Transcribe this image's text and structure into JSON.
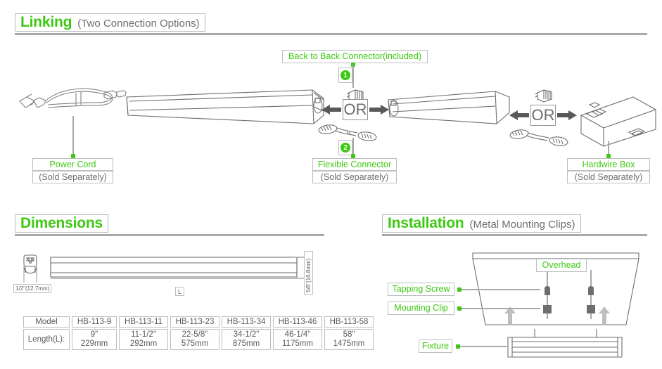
{
  "sections": {
    "linking": {
      "title": "Linking",
      "subtitle": "(Two Connection Options)"
    },
    "dimensions": {
      "title": "Dimensions",
      "subtitle": ""
    },
    "installation": {
      "title": "Installation",
      "subtitle": "(Metal Mounting Clips)"
    }
  },
  "linking": {
    "power_cord": {
      "name": "Power Cord",
      "note": "(Sold Separately)"
    },
    "back_to_back": {
      "name": "Back to Back Connector(included)",
      "badge": "1"
    },
    "flexible": {
      "name": "Flexible Connector",
      "note": "(Sold Separately)",
      "badge": "2"
    },
    "hardwire": {
      "name": "Hardwire Box",
      "note": "(Sold Separately)"
    },
    "or_left": "OR",
    "or_right": "OR"
  },
  "dimensions": {
    "width_label": "1/2\"(12.7mm)",
    "height_label": "5/8\"(16.8mm)",
    "length_marker": "L",
    "table": {
      "row_headers": [
        "Model",
        "Length(L):"
      ],
      "models": [
        "HB-113-9",
        "HB-113-11",
        "HB-113-23",
        "HB-113-34",
        "HB-113-46",
        "HB-113-58"
      ],
      "length_in": [
        "9\"",
        "11-1/2\"",
        "22-5/8\"",
        "34-1/2\"",
        "46-1/4\"",
        "58\""
      ],
      "length_mm": [
        "229mm",
        "292mm",
        "575mm",
        "875mm",
        "1175mm",
        "1475mm"
      ]
    }
  },
  "installation": {
    "overhead": "Overhead",
    "tapping_screw": "Tapping Screw",
    "mounting_clip": "Mounting Clip",
    "fixture": "Fixture"
  },
  "colors": {
    "green": "#3dc911",
    "gray_text": "#6d6e71",
    "line": "#a7a9ac",
    "border": "#bcbec0"
  }
}
